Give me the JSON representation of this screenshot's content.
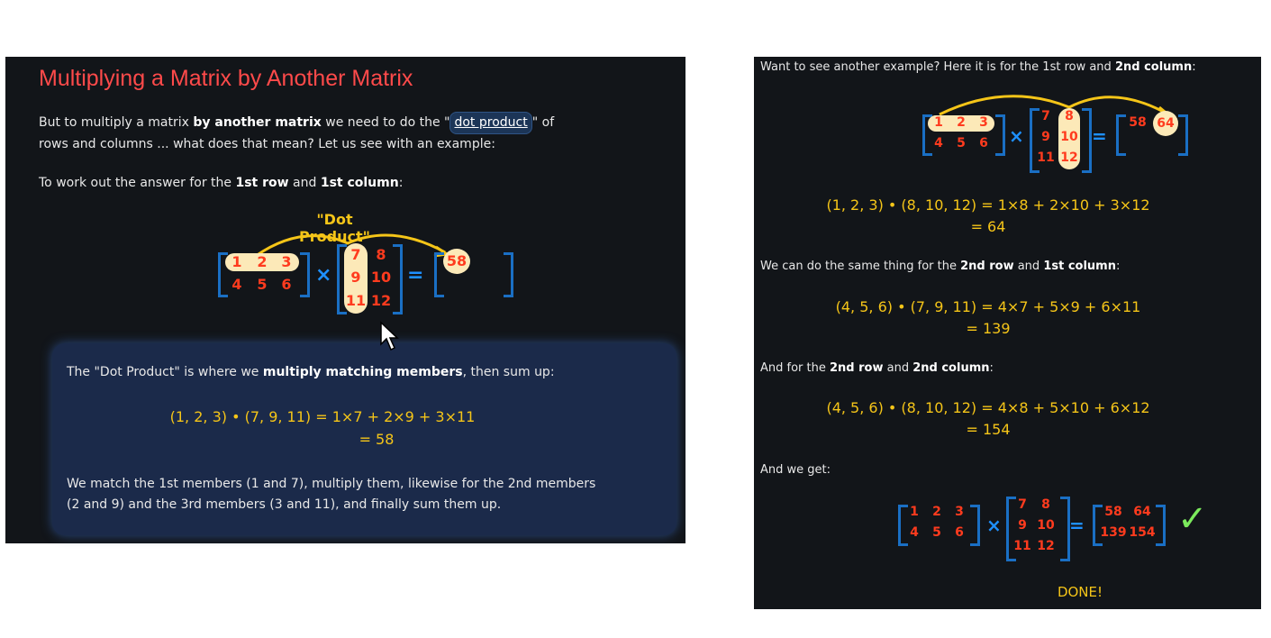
{
  "left": {
    "title": "Multiplying a Matrix by Another Matrix",
    "intro_pre": "But to multiply a matrix ",
    "intro_bold": "by another matrix",
    "intro_mid": " we need to do the \"",
    "intro_link": "dot product",
    "intro_post": "\" of",
    "intro_line2": "rows and columns ... what does that mean? Let us see with an example:",
    "work_pre": "To work out the answer for the ",
    "work_b1": "1st row",
    "work_and": " and ",
    "work_b2": "1st column",
    "work_colon": ":",
    "diagram_label": "\"Dot Product\"",
    "matA": [
      "1",
      "2",
      "3",
      "4",
      "5",
      "6"
    ],
    "matB": [
      "7",
      "8",
      "9",
      "10",
      "11",
      "12"
    ],
    "result": "58",
    "times": "×",
    "equals": "=",
    "box": {
      "line1_pre": "The \"Dot Product\" is where we ",
      "line1_bold": "multiply matching members",
      "line1_post": ", then sum up:",
      "eq1": "(1, 2, 3) • (7, 9, 11) = 1×7 + 2×9 + 3×11",
      "eq2": "= 58",
      "expl1": "We match the 1st members (1 and 7), multiply them, likewise for the 2nd members",
      "expl2": "(2 and 9) and the 3rd members (3 and 11), and finally sum them up."
    }
  },
  "right": {
    "intro_pre": "Want to see another example? Here it is for the 1st row and ",
    "intro_bold": "2nd column",
    "intro_post": ":",
    "result1": "58",
    "result2": "64",
    "eq1a": "(1, 2, 3) • (8, 10, 12) = 1×8 + 2×10 + 3×12",
    "eq1b": "= 64",
    "s2_pre": "We can do the same thing for the ",
    "s2_b1": "2nd row",
    "s2_and": " and ",
    "s2_b2": "1st column",
    "s2_post": ":",
    "eq2a": "(4, 5, 6) • (7, 9, 11) = 4×7 + 5×9 + 6×11",
    "eq2b": "= 139",
    "s3_pre": "And for the ",
    "s3_b1": "2nd row",
    "s3_and": " and ",
    "s3_b2": "2nd column",
    "s3_post": ":",
    "eq3a": "(4, 5, 6) • (8, 10, 12) = 4×8 + 5×10 + 6×12",
    "eq3b": "= 154",
    "s4": "And we get:",
    "final": [
      "58",
      "64",
      "139",
      "154"
    ],
    "done": "DONE!"
  },
  "colors": {
    "title": "#ff4a4a",
    "math": "#f5c518",
    "bracket": "#1a6fc4",
    "number": "#ff3b1e",
    "check": "#7bea5c"
  }
}
